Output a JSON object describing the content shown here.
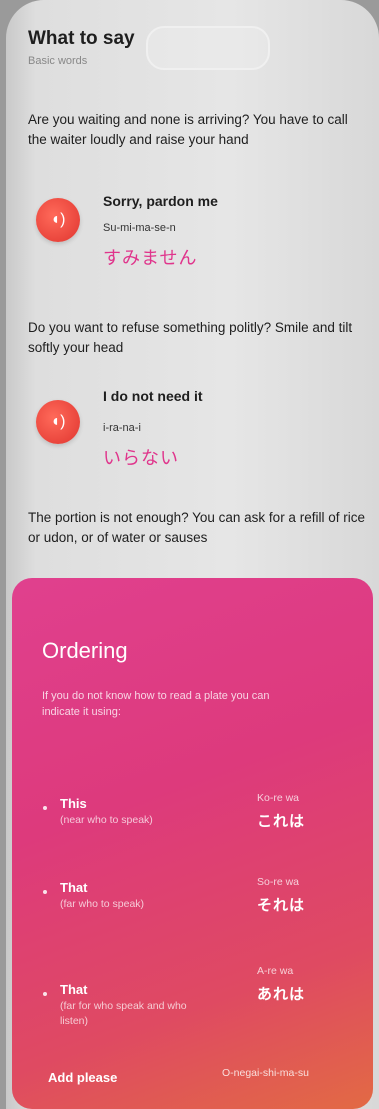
{
  "header": {
    "title": "What to say",
    "subtitle": "Basic words"
  },
  "sections": [
    {
      "text": "Are you waiting and none is arriving? You have to call the waiter loudly and raise your hand"
    },
    {
      "text": "Do you want to refuse something politly? Smile and tilt softly your head"
    },
    {
      "text": "The portion is not enough? You can ask for a refill of rice or udon, or of water or sauses"
    }
  ],
  "phrases": [
    {
      "title": "Sorry, pardon me",
      "romaji": "Su-mi-ma-se-n",
      "japanese": "すみません",
      "icon": "speaker-icon"
    },
    {
      "title": "I do not need it",
      "romaji": "i-ra-na-i",
      "japanese": "いらない",
      "icon": "speaker-icon"
    }
  ],
  "ordering": {
    "title": "Ordering",
    "description": "If you do not know how to read a plate you can indicate it using:",
    "items": [
      {
        "word": "This",
        "note": "(near who to speak)",
        "romaji": "Ko-re wa",
        "japanese": "これは"
      },
      {
        "word": "That",
        "note": "(far who to speak)",
        "romaji": "So-re wa",
        "japanese": "それは"
      },
      {
        "word": "That",
        "note": "(far for who speak and who listen)",
        "romaji": "A-re wa",
        "japanese": "あれは"
      }
    ],
    "add_word": "Add please",
    "add_romaji": "O-negai-shi-ma-su"
  },
  "colors": {
    "accent_pink": "#e0358c",
    "icon_red": "#e0352f",
    "card_start": "#e0408e",
    "card_end": "#e26a44"
  }
}
